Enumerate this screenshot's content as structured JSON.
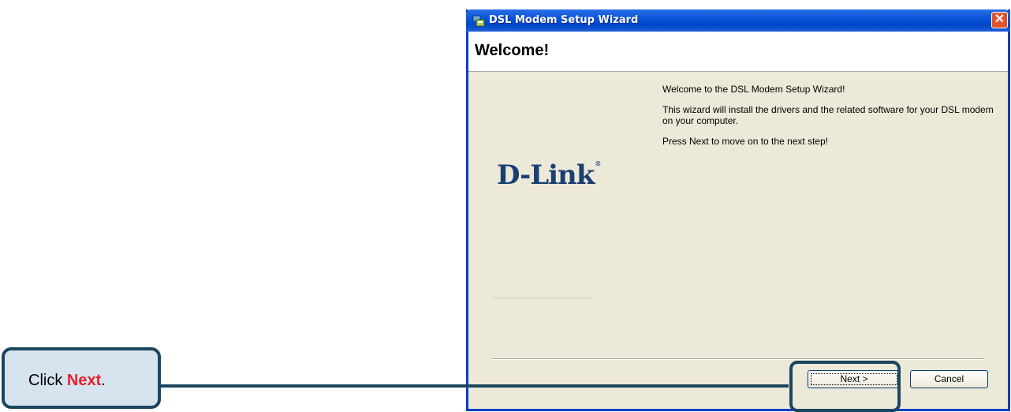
{
  "window": {
    "title": "DSL Modem Setup Wizard",
    "close_label": "✕",
    "icon": "setup-wizard-icon"
  },
  "header": {
    "title": "Welcome!"
  },
  "logo": {
    "text": "D-Link",
    "mark": "®"
  },
  "content": {
    "line1": "Welcome to the DSL Modem Setup Wizard!",
    "line2": "This wizard will install the drivers and the related software for your DSL modem on your computer.",
    "line3": "Press Next to move on to the next step!"
  },
  "buttons": {
    "next_label": "Next >",
    "cancel_label": "Cancel"
  },
  "callout": {
    "prefix": "Click ",
    "highlight": "Next",
    "suffix": "."
  },
  "colors": {
    "titlebar": "#0a55d8",
    "window_bg": "#ece9d8",
    "callout_border": "#1c4660",
    "callout_bg": "#d7e3ee",
    "callout_highlight": "#e6202a",
    "logo": "#1b3f71"
  }
}
